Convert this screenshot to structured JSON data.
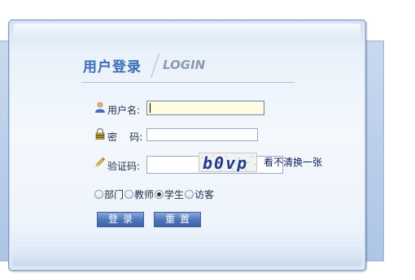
{
  "login": {
    "title_cn": "用户登录",
    "title_en": "LOGIN",
    "username_label": "用户名:",
    "username_value": "",
    "password_label": "密    码:",
    "password_value": "",
    "captcha_label": "验证码:",
    "captcha_value": "",
    "captcha_text": "b0vp",
    "refresh_link": "看不清换一张",
    "roles": [
      {
        "label": "部门",
        "checked": false
      },
      {
        "label": "教师",
        "checked": false
      },
      {
        "label": "学生",
        "checked": true
      },
      {
        "label": "访客",
        "checked": false
      }
    ],
    "login_button": "登录",
    "reset_button": "重置"
  },
  "icons": {
    "username": "user-icon",
    "password": "lock-icon",
    "captcha": "pencil-icon"
  },
  "colors": {
    "title": "#3b6bb5",
    "button": "#4e74b8",
    "panel": "#eef4fb"
  }
}
